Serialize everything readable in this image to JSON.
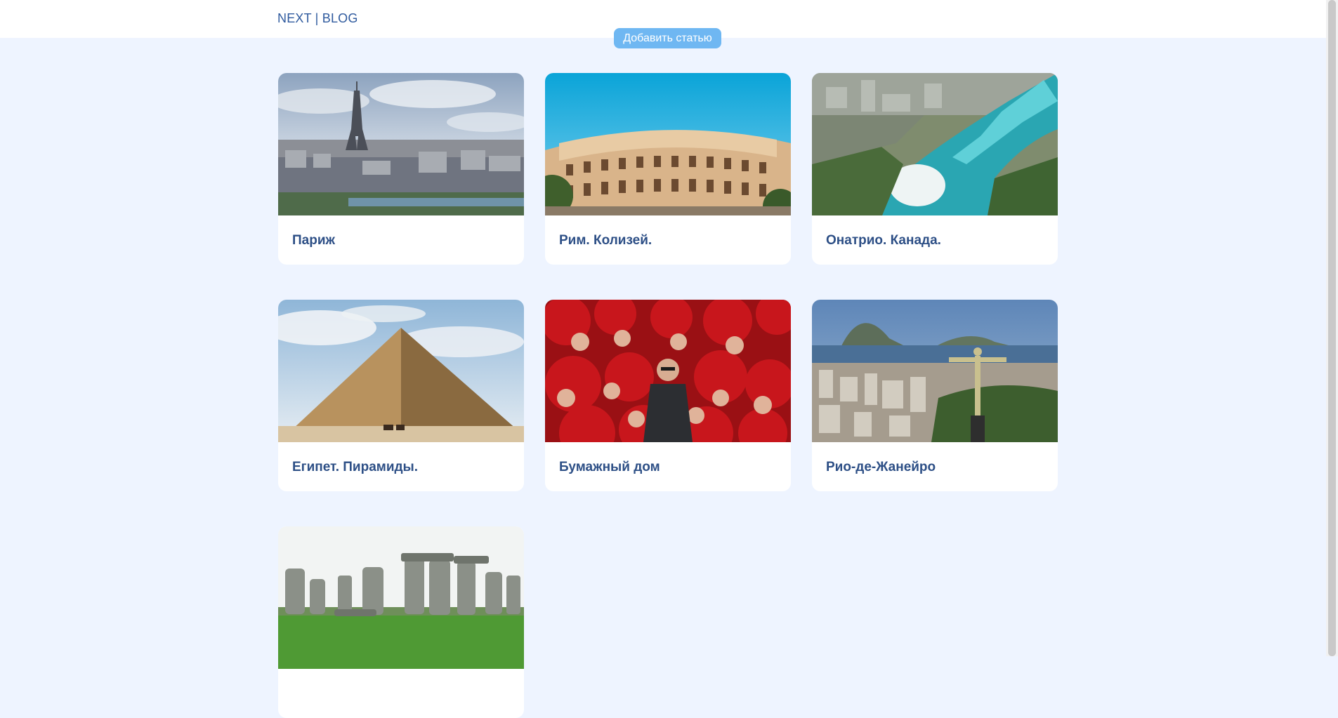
{
  "header": {
    "logo": "NEXT | BLOG",
    "add_button": "Добавить статью"
  },
  "cards": [
    {
      "title": "Париж",
      "image": "eiffel-tower-photo"
    },
    {
      "title": "Рим. Колизей.",
      "image": "colosseum-photo"
    },
    {
      "title": "Онатрио. Канада.",
      "image": "niagara-falls-photo"
    },
    {
      "title": "Египет. Пирамиды.",
      "image": "pyramid-photo"
    },
    {
      "title": "Бумажный дом",
      "image": "money-heist-cast-photo"
    },
    {
      "title": "Рио-де-Жанейро",
      "image": "christ-redeemer-photo"
    },
    {
      "title": "",
      "image": "stonehenge-photo"
    }
  ]
}
